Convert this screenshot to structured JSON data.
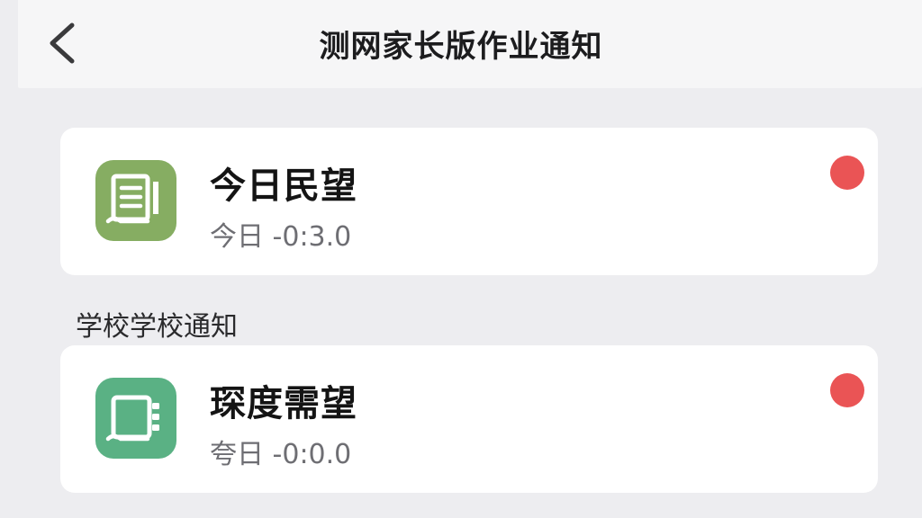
{
  "navbar": {
    "title": "测网家长版作业通知",
    "back_icon": "chevron-left-icon"
  },
  "cards": [
    {
      "title": "今日民望",
      "subtitle": "今日 -0:3.0",
      "icon": "document-icon",
      "icon_color": "#86ad62",
      "unread": true
    },
    {
      "title": "琛度需望",
      "subtitle": "夸日 -0:0.0",
      "icon": "notebook-icon",
      "icon_color": "#5ab184",
      "unread": true
    }
  ],
  "section": {
    "label": "学校学校通知"
  },
  "colors": {
    "background": "#ededf0",
    "card": "#ffffff",
    "badge": "#ea5455"
  }
}
